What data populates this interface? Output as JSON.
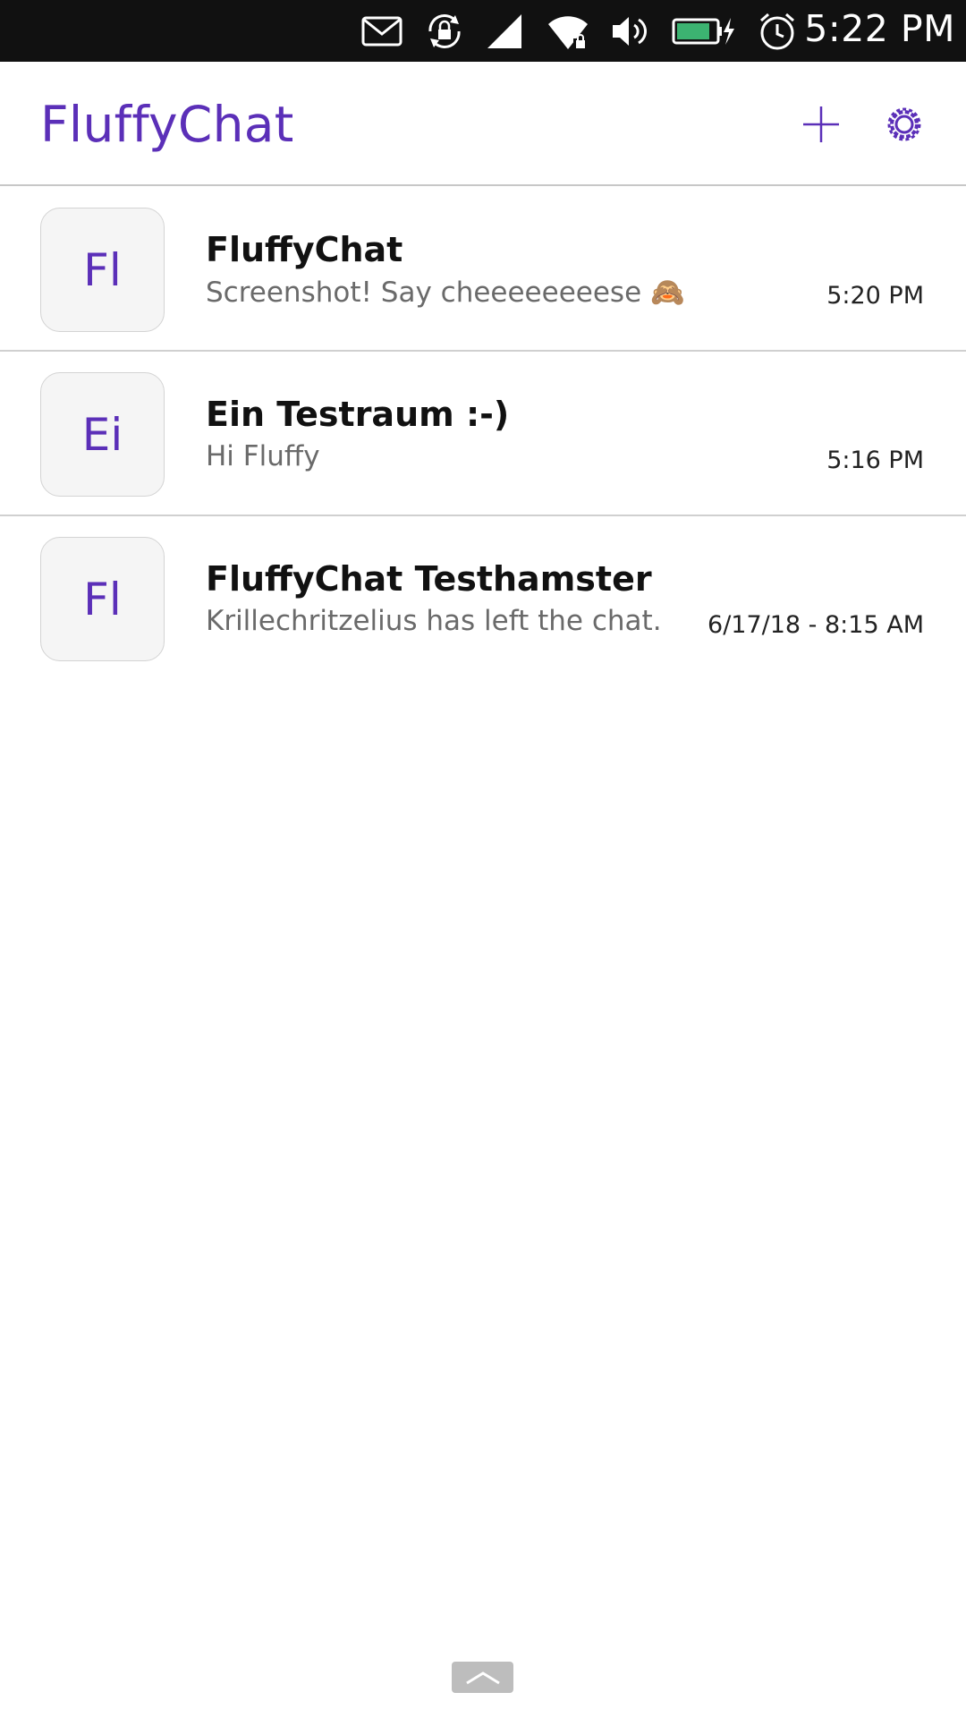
{
  "status_bar": {
    "time": "5:22 PM",
    "icons": [
      "mail-icon",
      "rotation-lock-icon",
      "cellular-signal-icon",
      "wifi-icon",
      "volume-icon",
      "battery-charging-icon",
      "alarm-icon"
    ],
    "battery_color": "#3cb371"
  },
  "header": {
    "title": "FluffyChat",
    "actions": [
      "add-icon",
      "settings-icon"
    ],
    "accent_color": "#5b2fb8"
  },
  "chats": [
    {
      "avatar": "Fl",
      "name": "FluffyChat",
      "preview": "Screenshot! Say cheeeeeeeese 🙈",
      "time": "5:20 PM"
    },
    {
      "avatar": "Ei",
      "name": "Ein Testraum :-)",
      "preview": "Hi Fluffy",
      "time": "5:16 PM"
    },
    {
      "avatar": "Fl",
      "name": "FluffyChat Testhamster",
      "preview": "Krillechritzelius has left the chat.",
      "time": "6/17/18 - 8:15 AM"
    }
  ],
  "bottom_edge": {
    "icon": "chevron-up-icon"
  }
}
